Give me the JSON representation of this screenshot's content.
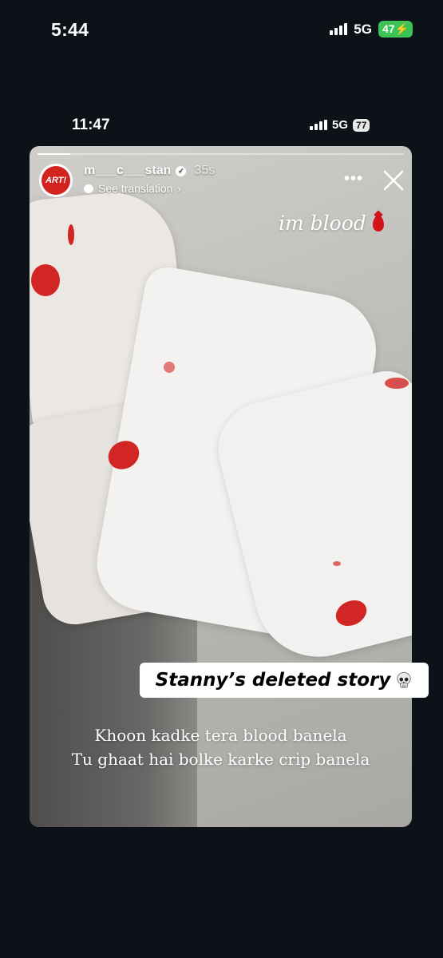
{
  "outer_status": {
    "time": "5:44",
    "network": "5G",
    "battery": "47"
  },
  "inner_status": {
    "time": "11:47",
    "network": "5G",
    "battery": "77"
  },
  "story": {
    "avatar_text": "ART!",
    "username": "m___c___stan",
    "time_ago": "35s",
    "see_translation": "See translation",
    "progress": 0.09,
    "sticker_text": "im blood",
    "lyrics_line1": "Khoon kadke tera blood banela",
    "lyrics_line2": "Tu ghaat hai bolke karke crip banela"
  },
  "caption_label": "Stanny’s deleted story",
  "colors": {
    "battery_green": "#3cc356",
    "blood_red": "#d12624",
    "background": "#0c1218"
  },
  "icons": [
    "signal-icon",
    "battery-icon",
    "verified-icon",
    "chat-bubble-icon",
    "more-icon",
    "close-icon",
    "blood-drop-icon",
    "skull-icon"
  ]
}
